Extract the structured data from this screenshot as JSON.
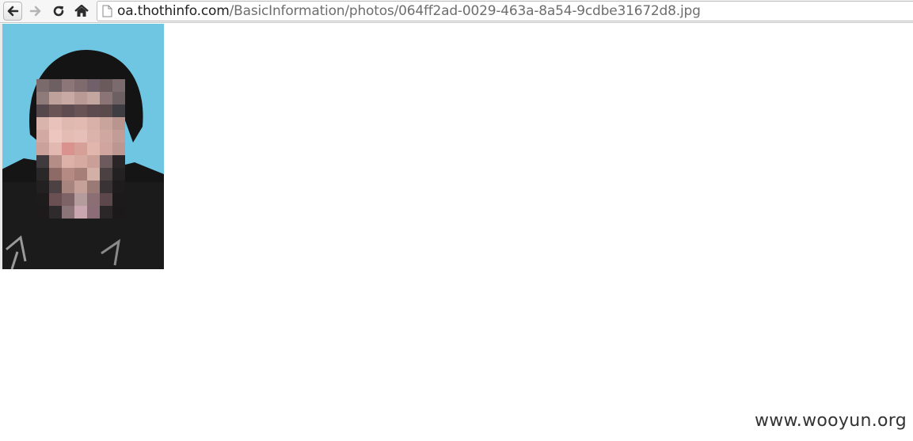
{
  "browser": {
    "icons": {
      "back": "arrow-left-icon",
      "forward": "arrow-right-icon",
      "reload": "reload-icon",
      "home": "home-icon",
      "page": "page-icon"
    },
    "address": {
      "host": "oa.thothinfo.com",
      "path": "/BasicInformation/photos/064ff2ad-0029-463a-8a54-9cdbe31672d8.jpg"
    }
  },
  "image": {
    "alt": "pixelated portrait photo",
    "background_color": "#6ec6e2"
  },
  "watermark": {
    "text": "www.wooyun.org"
  }
}
